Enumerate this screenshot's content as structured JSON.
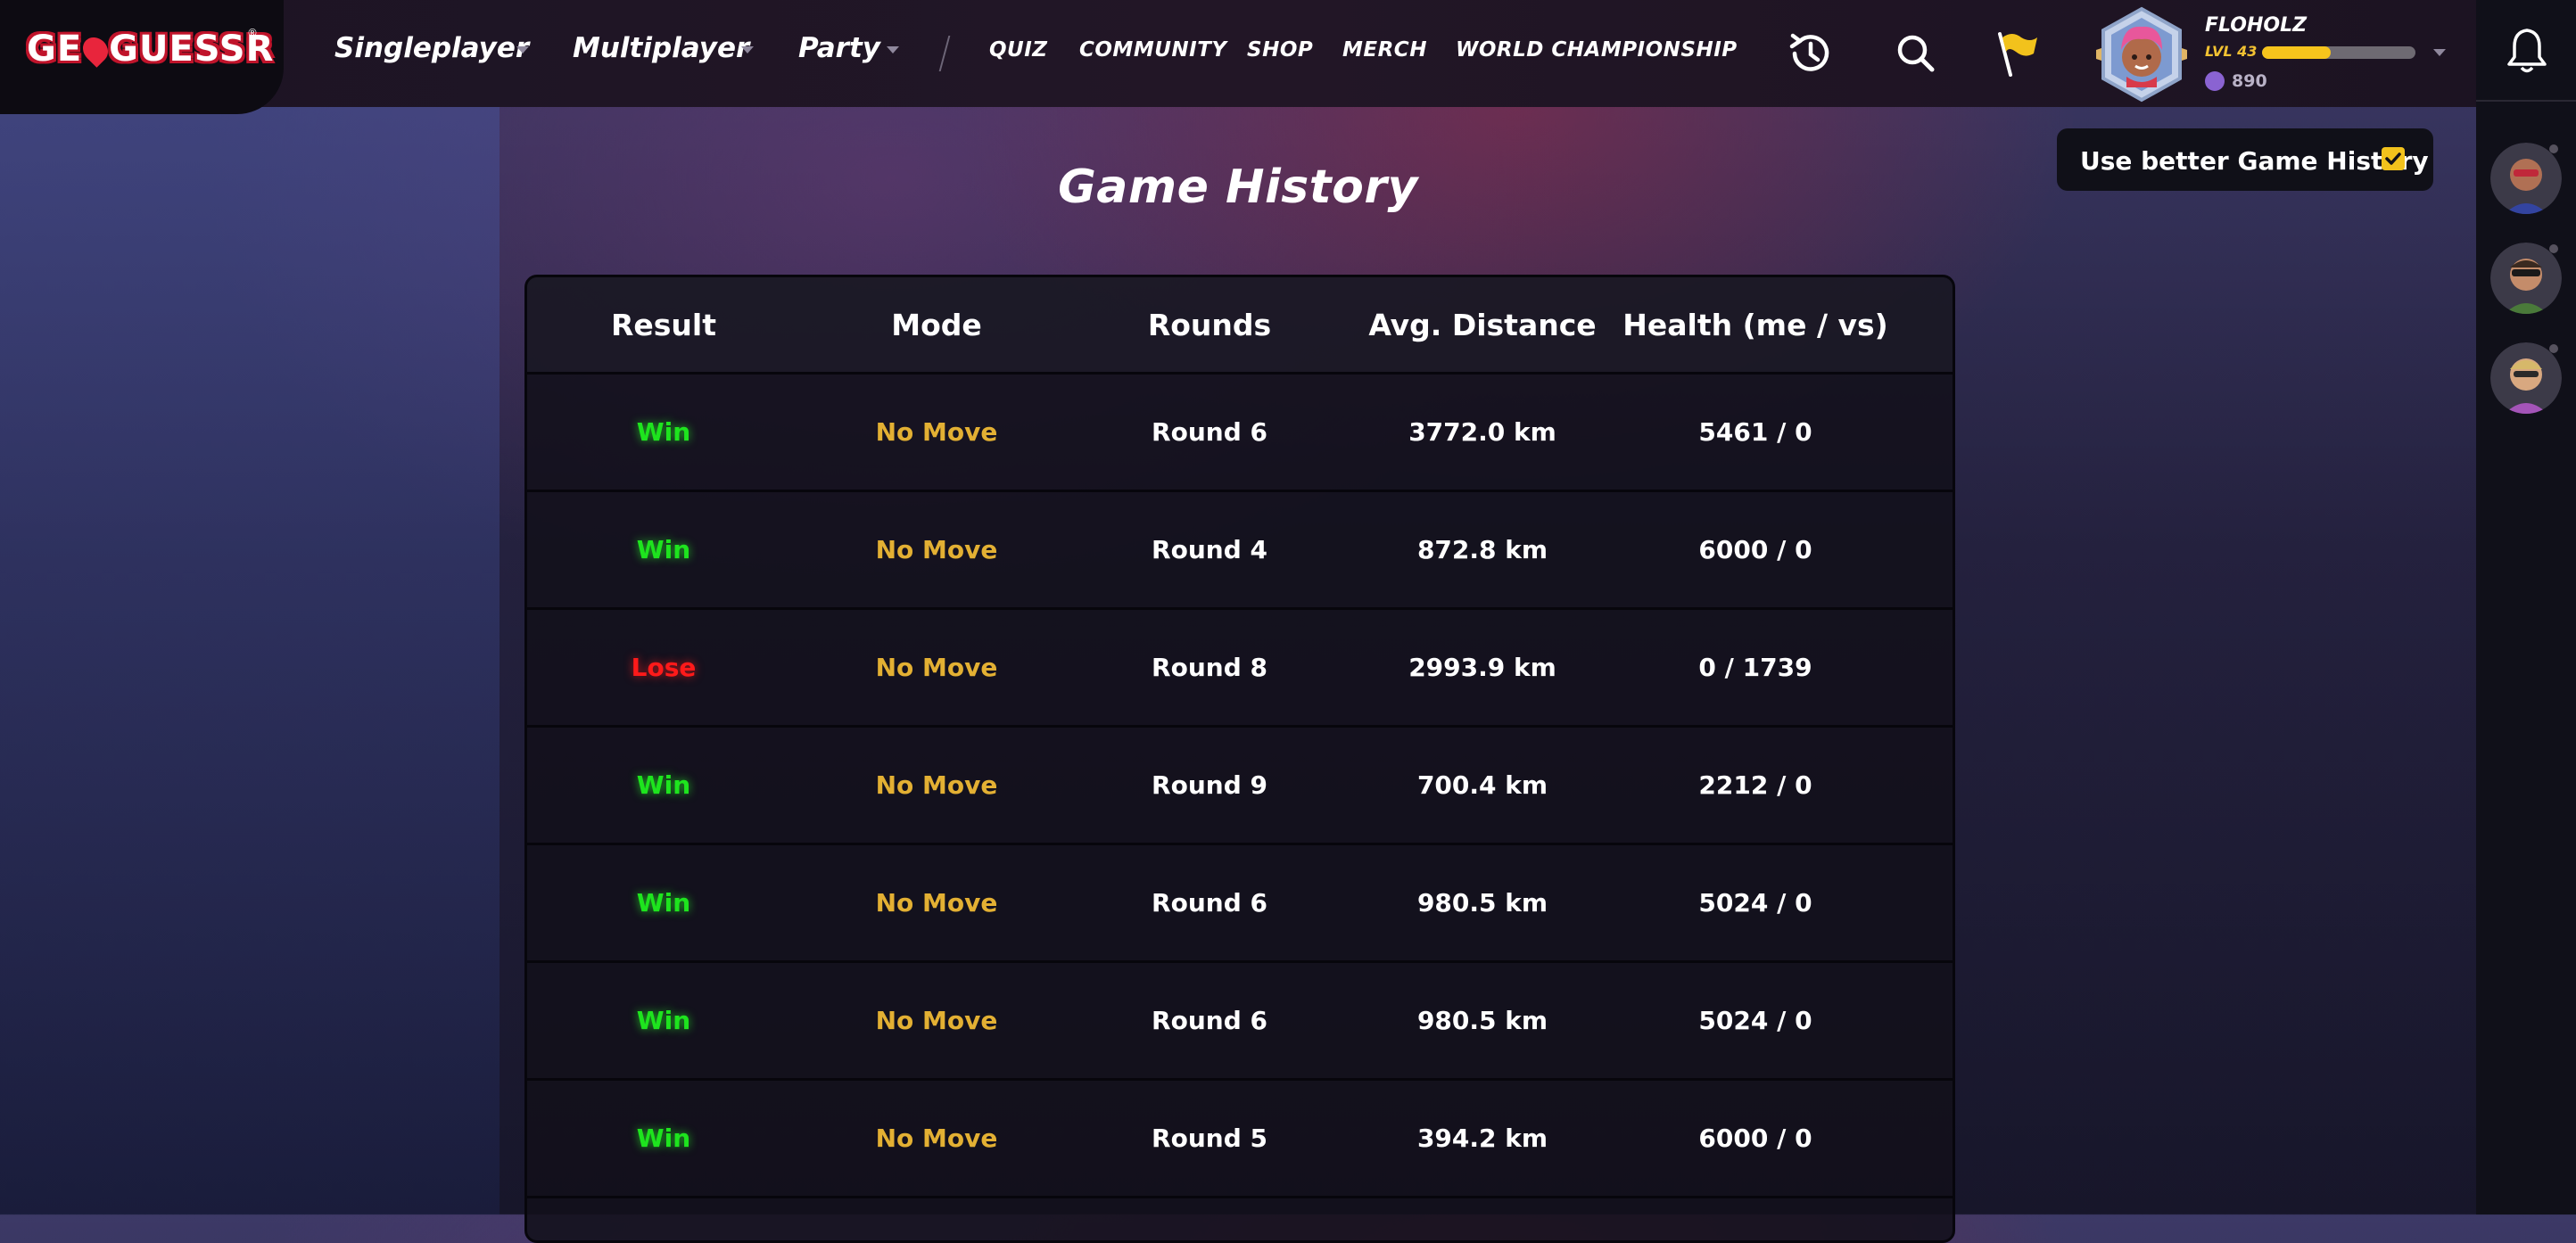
{
  "header": {
    "logo": "GEOGUESSR",
    "nav_main": [
      {
        "label": "Singleplayer"
      },
      {
        "label": "Multiplayer"
      },
      {
        "label": "Party"
      }
    ],
    "nav_sub": [
      "QUIZ",
      "COMMUNITY",
      "SHOP",
      "MERCH",
      "WORLD CHAMPIONSHIP"
    ],
    "icons": [
      "history-icon",
      "search-icon",
      "flag-icon"
    ],
    "profile": {
      "username": "FLOHOLZ",
      "level": "LVL 43",
      "xp_progress": 0.45,
      "coins": "890"
    }
  },
  "toggle": {
    "label": "Use better Game History",
    "checked": true
  },
  "page": {
    "title": "Game History"
  },
  "table": {
    "columns": [
      "Result",
      "Mode",
      "Rounds",
      "Avg. Distance",
      "Health (me / vs)"
    ],
    "rows": [
      {
        "result": "Win",
        "mode": "No Move",
        "rounds": "Round 6",
        "distance": "3772.0 km",
        "health": "5461 / 0"
      },
      {
        "result": "Win",
        "mode": "No Move",
        "rounds": "Round 4",
        "distance": "872.8 km",
        "health": "6000 / 0"
      },
      {
        "result": "Lose",
        "mode": "No Move",
        "rounds": "Round 8",
        "distance": "2993.9 km",
        "health": "0 / 1739"
      },
      {
        "result": "Win",
        "mode": "No Move",
        "rounds": "Round 9",
        "distance": "700.4 km",
        "health": "2212 / 0"
      },
      {
        "result": "Win",
        "mode": "No Move",
        "rounds": "Round 6",
        "distance": "980.5 km",
        "health": "5024 / 0"
      },
      {
        "result": "Win",
        "mode": "No Move",
        "rounds": "Round 6",
        "distance": "980.5 km",
        "health": "5024 / 0"
      },
      {
        "result": "Win",
        "mode": "No Move",
        "rounds": "Round 5",
        "distance": "394.2 km",
        "health": "6000 / 0"
      }
    ]
  },
  "colors": {
    "win": "#1ee41e",
    "lose": "#ff1a1a",
    "mode": "#e3b033",
    "accent": "#f2c21c"
  }
}
